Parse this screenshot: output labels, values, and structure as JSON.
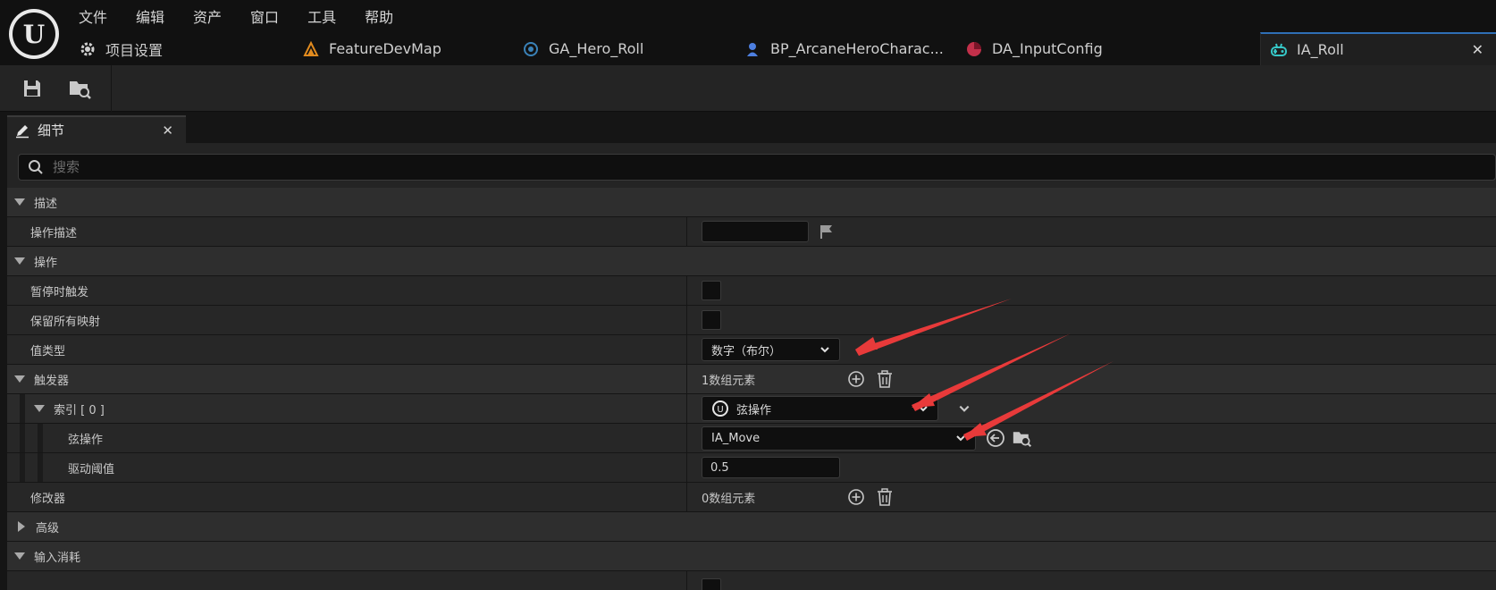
{
  "menu": [
    "文件",
    "编辑",
    "资产",
    "窗口",
    "工具",
    "帮助"
  ],
  "tabs": [
    {
      "label": "项目设置",
      "icon": "gear-icon"
    },
    {
      "label": "FeatureDevMap",
      "icon": "level-icon"
    },
    {
      "label": "GA_Hero_Roll",
      "icon": "ability-icon"
    },
    {
      "label": "BP_ArcaneHeroCharac...",
      "icon": "character-icon"
    },
    {
      "label": "DA_InputConfig",
      "icon": "data-asset-icon"
    },
    {
      "label": "IA_Roll",
      "icon": "input-action-icon"
    }
  ],
  "toolbar": {
    "save": "save-icon",
    "browse": "browse-icon"
  },
  "panel": {
    "title": "细节"
  },
  "search": {
    "placeholder": "搜索"
  },
  "sections": {
    "description": "描述",
    "action": "操作",
    "triggers": "触发器",
    "advanced": "高级",
    "input_consumption": "输入消耗"
  },
  "props": {
    "action_description": {
      "label": "操作描述",
      "value": ""
    },
    "trigger_when_paused": {
      "label": "暂停时触发",
      "checked": false
    },
    "reserve_all_mappings": {
      "label": "保留所有映射",
      "checked": false
    },
    "value_type": {
      "label": "值类型",
      "value": "数字（布尔）"
    },
    "triggers_count": "1数组元素",
    "index0": {
      "label": "索引 [ 0 ]",
      "value": "弦操作"
    },
    "chord_action": {
      "label": "弦操作",
      "value": "IA_Move"
    },
    "actuation_threshold": {
      "label": "驱动阈值",
      "value": "0.5"
    },
    "modifiers": {
      "label": "修改器",
      "count": "0数组元素"
    }
  },
  "colors": {
    "accent": "#2f6fb6",
    "arrow": "#e83a3a"
  }
}
